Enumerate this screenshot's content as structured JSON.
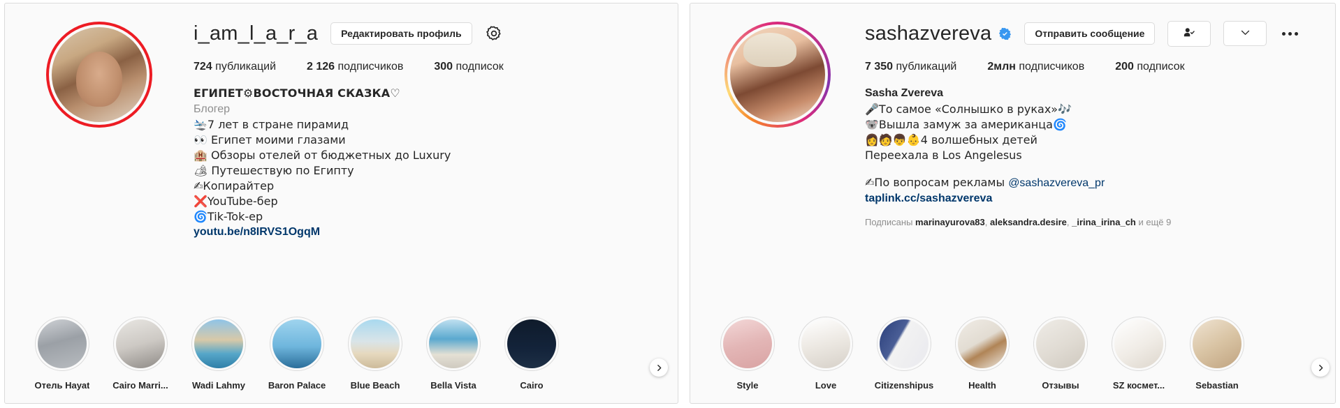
{
  "colors": {
    "story_ring_left": "#ed1c24",
    "story_ring_right_gradient": "#dd2a7b",
    "link": "#00376b",
    "text": "#262626",
    "muted": "#8e8e8e",
    "verified_badge": "#3897f0",
    "panel_bg": "#fafafa",
    "border": "#dbdbdb"
  },
  "left_profile": {
    "avatar_name": "avatar-i-am-l-a-r-a",
    "username": "i_am_l_a_r_a",
    "edit_button": "Редактировать профиль",
    "gear_icon": "gear-icon",
    "stats": [
      {
        "value": "724",
        "label": "публикаций"
      },
      {
        "value": "2 126",
        "label": "подписчиков"
      },
      {
        "value": "300",
        "label": "подписок"
      }
    ],
    "bio": {
      "title": "ЕГИПЕТ⚙ВОСТОЧНАЯ СКАЗКА♡",
      "subtitle": "Блогер",
      "lines": [
        "🛬7 лет в стране пирамид",
        "👀 Египет моими глазами",
        "🏨 Обзоры отелей от бюджетных до Luxury",
        "🏕 Путешествую по Египту",
        "✍Копирайтер",
        "❌YouTube-бер",
        "🌀Tik-Tok-ер"
      ],
      "link": "youtu.be/n8IRVS1OgqM"
    },
    "highlights": [
      {
        "label": "Отель Hayat",
        "thumb": "pyramids"
      },
      {
        "label": "Cairo Marri...",
        "thumb": "marriott"
      },
      {
        "label": "Wadi Lahmy",
        "thumb": "resort-pool"
      },
      {
        "label": "Baron Palace",
        "thumb": "sea-sky"
      },
      {
        "label": "Blue Beach",
        "thumb": "beach"
      },
      {
        "label": "Bella Vista",
        "thumb": "aerial-sea"
      },
      {
        "label": "Cairo",
        "thumb": "night-city"
      }
    ],
    "next_arrow": "chevron-right-icon"
  },
  "right_profile": {
    "avatar_name": "avatar-sashazvereva",
    "username": "sashazvereva",
    "verified": true,
    "message_button": "Отправить сообщение",
    "following_icon": "person-check-icon",
    "dropdown_icon": "chevron-down-icon",
    "more_icon": "more-options-icon",
    "stats": [
      {
        "value": "7 350",
        "label": "публикаций"
      },
      {
        "value": "2млн",
        "label": "подписчиков"
      },
      {
        "value": "200",
        "label": "подписок"
      }
    ],
    "bio": {
      "name": "Sasha Zvereva",
      "lines": [
        "🎤То самое «Солнышко в руках»🎶",
        "🐨Вышла замуж за американца🌀",
        "👩🧑👦👶4 волшебных детей",
        "Переехала в Los Angelesus"
      ],
      "ad_prefix": "✍По вопросам рекламы ",
      "ad_mention": "@sashazvereva_pr",
      "link": "taplink.cc/sashazvereva"
    },
    "followed_by": {
      "prefix": "Подписаны ",
      "names": [
        "marinayurova83",
        "aleksandra.desire",
        "_irina_irina_ch"
      ],
      "suffix": " и ещё 9"
    },
    "highlights": [
      {
        "label": "Style",
        "thumb": "pink-texture"
      },
      {
        "label": "Love",
        "thumb": "white-petals"
      },
      {
        "label": "Citizenshipus",
        "thumb": "us-flag"
      },
      {
        "label": "Health",
        "thumb": "wood-brush"
      },
      {
        "label": "Отзывы",
        "thumb": "lace"
      },
      {
        "label": "SZ космет...",
        "thumb": "silk"
      },
      {
        "label": "Sebastian",
        "thumb": "hair"
      }
    ],
    "next_arrow": "chevron-right-icon"
  }
}
